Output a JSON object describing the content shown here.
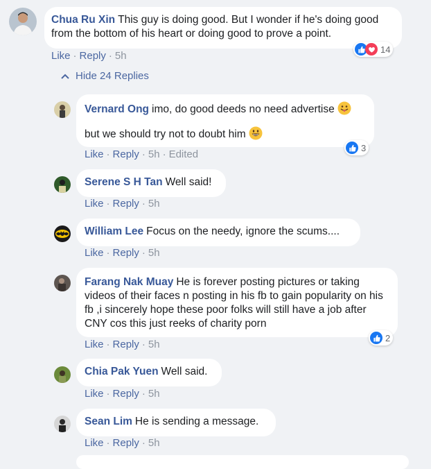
{
  "comments": [
    {
      "name": "Chua Ru Xin",
      "text": "This guy is doing good. But I wonder if he's doing good from the bottom of his heart or doing good to prove a point.",
      "actions": {
        "like": "Like",
        "reply": "Reply",
        "time": "5h"
      },
      "reaction_count": "14"
    }
  ],
  "hide_replies_label": "Hide 24 Replies",
  "replies": [
    {
      "name": "Vernard Ong",
      "line1": "imo, do good deeds no need advertise",
      "line2": "but we should try not to doubt him",
      "actions": {
        "like": "Like",
        "reply": "Reply",
        "time": "5h",
        "edited": "Edited"
      },
      "reaction_count": "3"
    },
    {
      "name": "Serene S H Tan",
      "text": "Well said!",
      "actions": {
        "like": "Like",
        "reply": "Reply",
        "time": "5h"
      }
    },
    {
      "name": "William Lee",
      "text": "Focus on the needy, ignore the scums....",
      "actions": {
        "like": "Like",
        "reply": "Reply",
        "time": "5h"
      }
    },
    {
      "name": "Farang Nak Muay",
      "text": "He is forever posting pictures or taking videos of their faces n posting in his fb to gain popularity on his fb ,i sincerely hope these poor folks will still have a job after CNY cos this just reeks of charity porn",
      "actions": {
        "like": "Like",
        "reply": "Reply",
        "time": "5h"
      },
      "reaction_count": "2"
    },
    {
      "name": "Chia Pak Yuen",
      "text": "Well said.",
      "actions": {
        "like": "Like",
        "reply": "Reply",
        "time": "5h"
      }
    },
    {
      "name": "Sean Lim",
      "text": "He is sending a message.",
      "actions": {
        "like": "Like",
        "reply": "Reply",
        "time": "5h"
      }
    }
  ],
  "colors": {
    "name": "#385898",
    "action": "#4b67a1",
    "muted": "#8d949e",
    "like_blue": "#1877f2",
    "love_red": "#f33e58",
    "bg": "#f0f2f5"
  }
}
